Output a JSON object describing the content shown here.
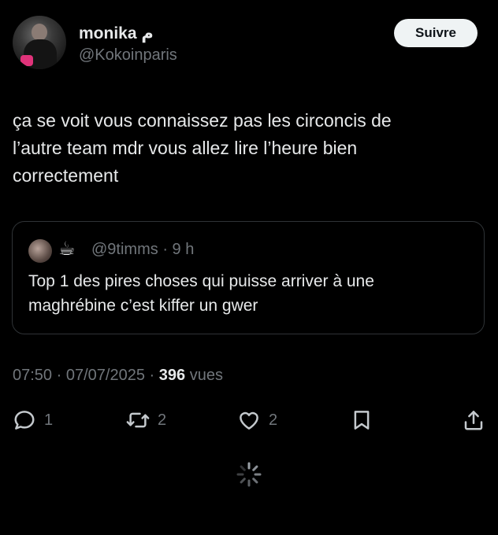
{
  "author": {
    "name": "monika م",
    "handle": "@Kokoinparis"
  },
  "follow_label": "Suivre",
  "tweet": {
    "text": "ça se voit vous connaissez pas les circoncis de\nl’autre team mdr vous allez lire l’heure bien\ncorrectement"
  },
  "quote": {
    "emoji": "☕",
    "handle": "@9timms",
    "sep": "·",
    "time": "9 h",
    "text": "Top 1 des pires choses qui puisse arriver à une\nmaghrébine c’est kiffer un gwer"
  },
  "meta": {
    "time": "07:50",
    "sep1": "·",
    "date": "07/07/2025",
    "sep2": "·",
    "views_count": "396",
    "views_label": "vues"
  },
  "actions": {
    "replies": "1",
    "retweets": "2",
    "likes": "2"
  },
  "icons": [
    "reply-icon",
    "retweet-icon",
    "like-icon",
    "bookmark-icon",
    "share-icon",
    "loading-spinner-icon"
  ]
}
